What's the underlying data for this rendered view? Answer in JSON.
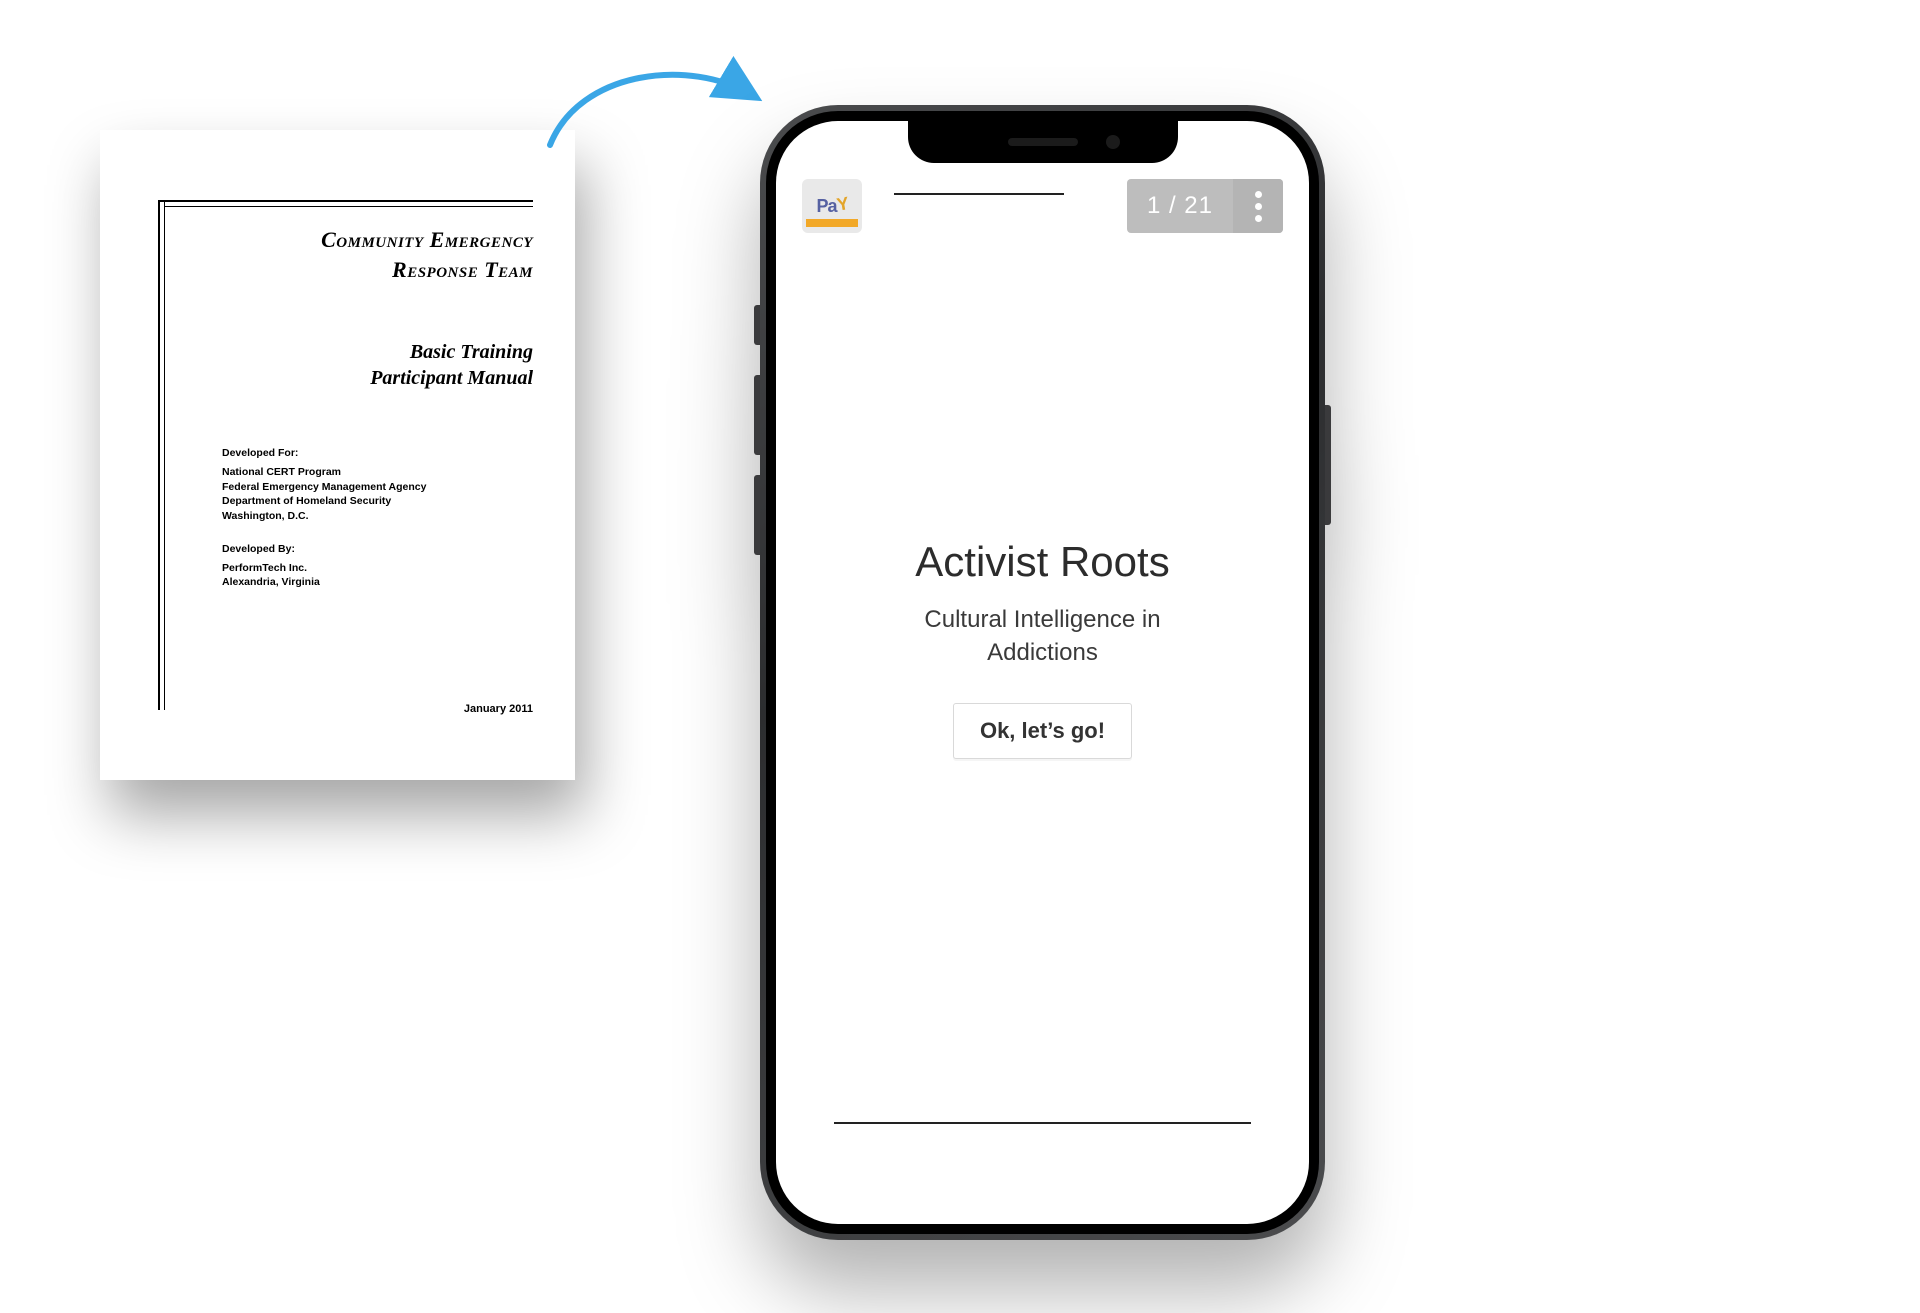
{
  "document": {
    "title_line1": "Community Emergency",
    "title_line2": "Response Team",
    "subtitle_line1": "Basic Training",
    "subtitle_line2": "Participant Manual",
    "developed_for_label": "Developed For:",
    "developed_for_lines": [
      "National CERT Program",
      "Federal Emergency Management Agency",
      "Department of Homeland Security",
      "Washington, D.C."
    ],
    "developed_by_label": "Developed By:",
    "developed_by_lines": [
      "PerformTech Inc.",
      "Alexandria, Virginia"
    ],
    "date": "January 2011"
  },
  "arrow": {
    "color": "#3aa6e6"
  },
  "phone": {
    "logo_text": "Pa",
    "logo_accent": "Y",
    "pager": "1 / 21",
    "app_title": "Activist Roots",
    "app_subtitle": "Cultural Intelligence in Addictions",
    "cta_label": "Ok, let’s go!"
  }
}
